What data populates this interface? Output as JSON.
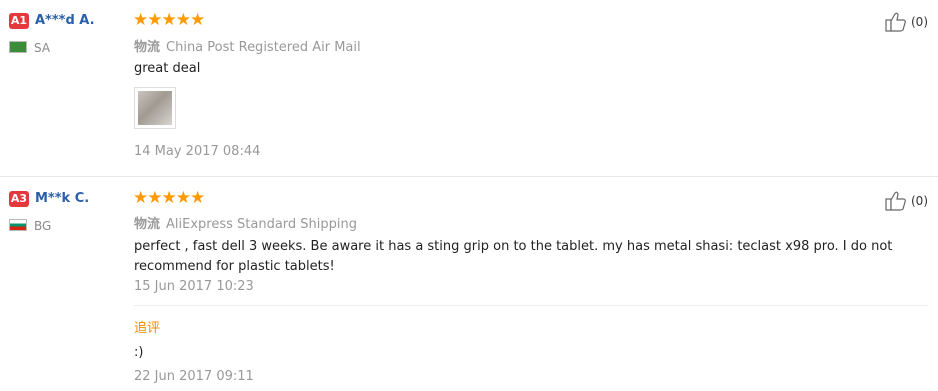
{
  "reviews": [
    {
      "level": "A1",
      "level_color": "#e4393c",
      "name": "A***d A.",
      "country": "SA",
      "flag_colors": [
        "#3c8d3a",
        "#3c8d3a"
      ],
      "stars": "★★★★★",
      "shipping_label": "物流",
      "shipping": "China Post Registered Air Mail",
      "text": "great deal",
      "date": "14 May 2017 08:44",
      "helpful_count": "(0)"
    },
    {
      "level": "A3",
      "level_color": "#e4393c",
      "name": "M**k C.",
      "country": "BG",
      "flag_colors": [
        "#ffffff",
        "#00966e",
        "#d62612"
      ],
      "stars": "★★★★★",
      "shipping_label": "物流",
      "shipping": "AliExpress Standard Shipping",
      "text": "perfect , fast dell 3 weeks. Be aware it has a sting grip on to the tablet. my has metal shasi: teclast x98 pro. I do not recommend for plastic tablets!",
      "date": "15 Jun 2017 10:23",
      "helpful_count": "(0)",
      "followup": {
        "label": "追评",
        "text": ":)",
        "date": "22 Jun 2017 09:11"
      }
    }
  ],
  "colors": {
    "star": "#ff9a00",
    "name": "#2a5fa9",
    "followup_label": "#f28b00"
  }
}
